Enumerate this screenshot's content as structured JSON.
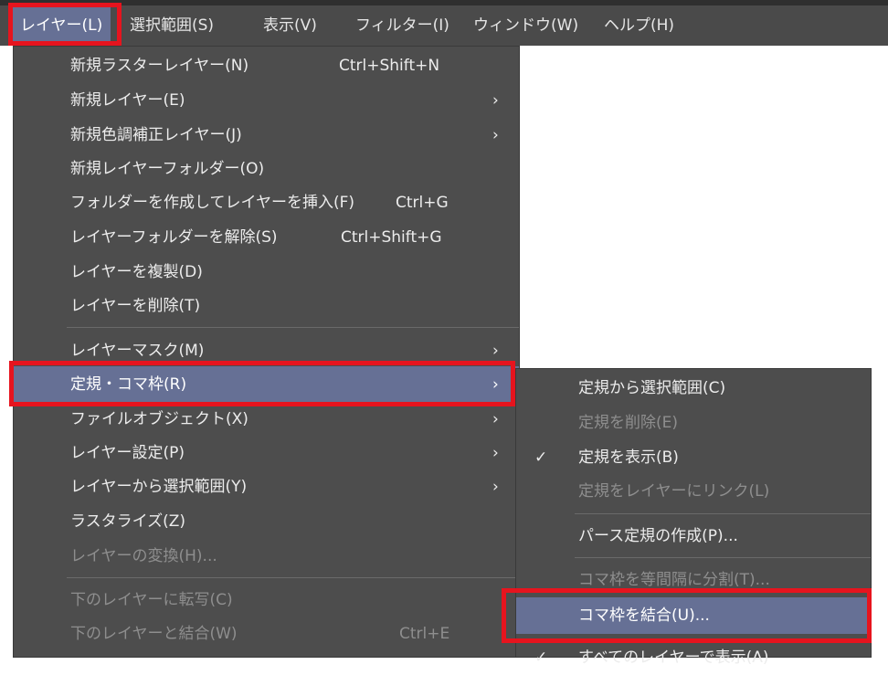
{
  "menubar": {
    "items": [
      {
        "label": "レイヤー(L)"
      },
      {
        "label": "選択範囲(S)"
      },
      {
        "label": "表示(V)"
      },
      {
        "label": "フィルター(I)"
      },
      {
        "label": "ウィンドウ(W)"
      },
      {
        "label": "ヘルプ(H)"
      }
    ]
  },
  "layer_menu": {
    "items": [
      {
        "label": "新規ラスターレイヤー(N)",
        "shortcut": "Ctrl+Shift+N"
      },
      {
        "label": "新規レイヤー(E)",
        "arrow": "›"
      },
      {
        "label": "新規色調補正レイヤー(J)",
        "arrow": "›"
      },
      {
        "label": "新規レイヤーフォルダー(O)"
      },
      {
        "label": "フォルダーを作成してレイヤーを挿入(F)",
        "shortcut": "Ctrl+G"
      },
      {
        "label": "レイヤーフォルダーを解除(S)",
        "shortcut": "Ctrl+Shift+G"
      },
      {
        "label": "レイヤーを複製(D)"
      },
      {
        "label": "レイヤーを削除(T)"
      },
      {
        "label": "レイヤーマスク(M)",
        "arrow": "›"
      },
      {
        "label": "定規・コマ枠(R)",
        "arrow": "›"
      },
      {
        "label": "ファイルオブジェクト(X)",
        "arrow": "›"
      },
      {
        "label": "レイヤー設定(P)",
        "arrow": "›"
      },
      {
        "label": "レイヤーから選択範囲(Y)",
        "arrow": "›"
      },
      {
        "label": "ラスタライズ(Z)"
      },
      {
        "label": "レイヤーの変換(H)..."
      },
      {
        "label": "下のレイヤーに転写(C)"
      },
      {
        "label": "下のレイヤーと結合(W)",
        "shortcut": "Ctrl+E"
      }
    ]
  },
  "ruler_submenu": {
    "items": [
      {
        "label": "定規から選択範囲(C)"
      },
      {
        "label": "定規を削除(E)"
      },
      {
        "label": "定規を表示(B)",
        "check": "✓"
      },
      {
        "label": "定規をレイヤーにリンク(L)"
      },
      {
        "label": "パース定規の作成(P)..."
      },
      {
        "label": "コマ枠を等間隔に分割(T)..."
      },
      {
        "label": "コマ枠を結合(U)..."
      },
      {
        "label": "すべてのレイヤーで表示(A)",
        "check": "✓"
      }
    ]
  }
}
